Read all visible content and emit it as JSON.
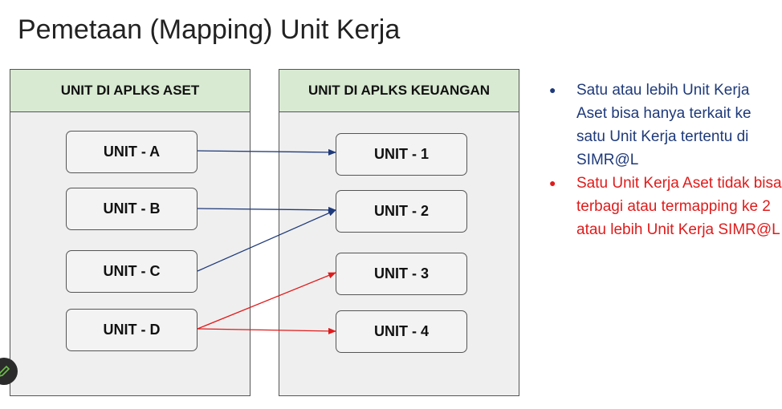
{
  "title": "Pemetaan (Mapping) Unit Kerja",
  "left_panel": {
    "header": "UNIT DI APLKS ASET",
    "units": [
      "UNIT - A",
      "UNIT - B",
      "UNIT - C",
      "UNIT - D"
    ]
  },
  "right_panel": {
    "header": "UNIT DI APLKS KEUANGAN",
    "units": [
      "UNIT - 1",
      "UNIT - 2",
      "UNIT - 3",
      "UNIT - 4"
    ]
  },
  "mappings": [
    {
      "from": "UNIT - A",
      "to": "UNIT - 1",
      "color": "#1f3a7a"
    },
    {
      "from": "UNIT - B",
      "to": "UNIT - 2",
      "color": "#1f3a7a"
    },
    {
      "from": "UNIT - C",
      "to": "UNIT - 2",
      "color": "#1f3a7a"
    },
    {
      "from": "UNIT - D",
      "to": "UNIT - 3",
      "color": "#e01b1b"
    },
    {
      "from": "UNIT - D",
      "to": "UNIT - 4",
      "color": "#e01b1b"
    }
  ],
  "notes": [
    {
      "text": "Satu atau lebih Unit Kerja Aset bisa hanya terkait ke satu Unit Kerja tertentu di SIMR@L",
      "color": "#1f3a7a"
    },
    {
      "text": "Satu Unit Kerja Aset tidak bisa terbagi atau termapping ke 2 atau lebih Unit Kerja SIMR@L",
      "color": "#e01b1b"
    }
  ],
  "bullet_char": "●",
  "pen_icon": "pencil-icon"
}
